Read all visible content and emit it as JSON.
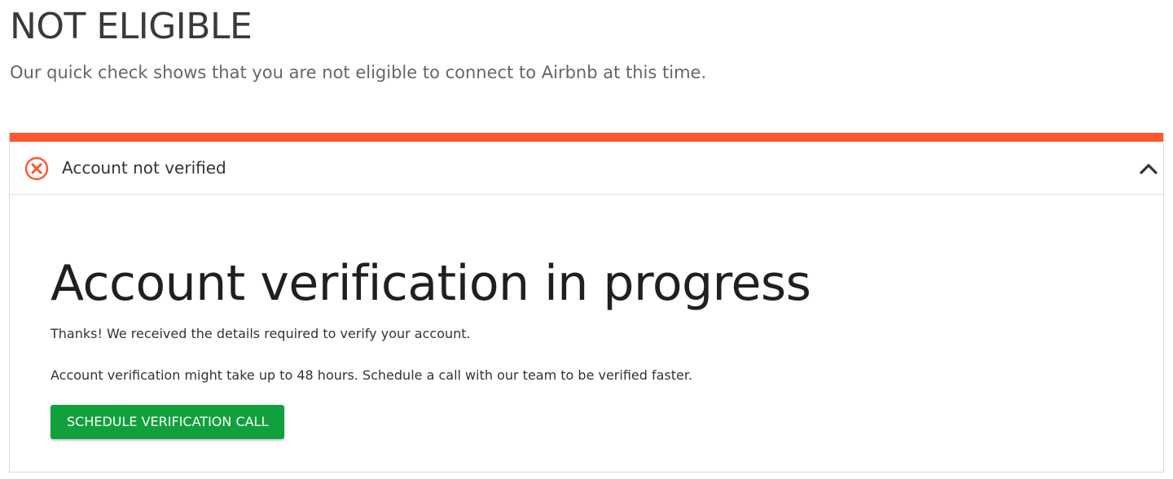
{
  "header": {
    "title": "NOT ELIGIBLE",
    "subtitle": "Our quick check shows that you are not eligible to connect to Airbnb at this time."
  },
  "card": {
    "accent_color": "#ff5630",
    "status_icon": "x-circle-icon",
    "status_title": "Account not verified",
    "toggle_icon": "chevron-up-icon",
    "body": {
      "title": "Account verification in progress",
      "text1": "Thanks! We received the details required to verify your account.",
      "text2": "Account verification might take up to 48 hours. Schedule a call with our team to be verified faster.",
      "button_label": "SCHEDULE VERIFICATION CALL",
      "button_color": "#10a13c"
    }
  }
}
